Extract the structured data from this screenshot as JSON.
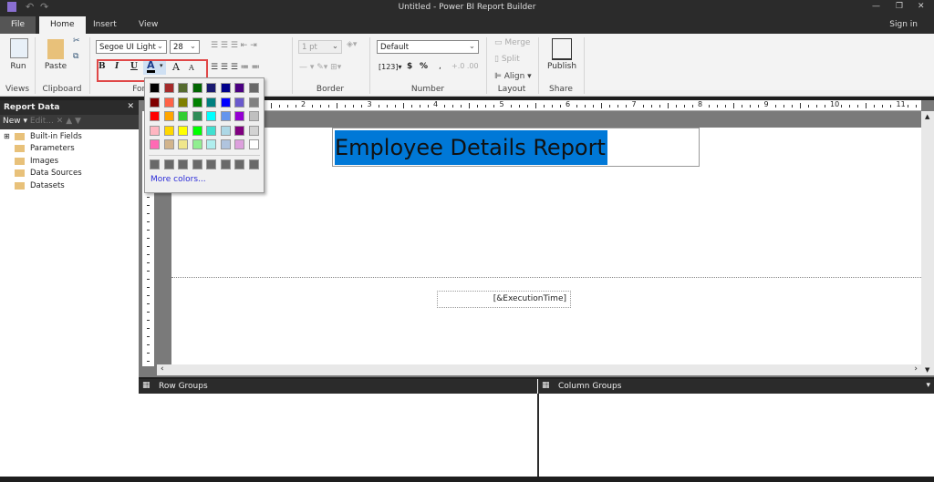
{
  "window": {
    "title": "Untitled - Power BI Report Builder",
    "sign_in": "Sign in"
  },
  "tabs": [
    "File",
    "Home",
    "Insert",
    "View"
  ],
  "ribbon": {
    "views": {
      "run": "Run",
      "group": "Views"
    },
    "clipboard": {
      "paste": "Paste",
      "group": "Clipboard"
    },
    "font": {
      "family": "Segoe UI Light",
      "size": "28",
      "bold": "B",
      "italic": "I",
      "underline": "U",
      "font_color": "A",
      "grow": "A",
      "shrink": "A",
      "group": "Font"
    },
    "border": {
      "width": "1 pt",
      "group": "Border"
    },
    "number": {
      "format": "Default",
      "dollar": "$",
      "percent": "%",
      "comma": ",",
      "group": "Number"
    },
    "layout": {
      "merge": "Merge",
      "split": "Split",
      "align": "Align",
      "group": "Layout"
    },
    "share": {
      "publish": "Publish",
      "group": "Share"
    }
  },
  "color_palette": {
    "rows": [
      [
        "#000000",
        "#a52a2a",
        "#556b2f",
        "#006400",
        "#191970",
        "#00008b",
        "#4b0082",
        "#696969"
      ],
      [
        "#800000",
        "#ff6347",
        "#808000",
        "#008000",
        "#008080",
        "#0000ff",
        "#6a5acd",
        "#808080"
      ],
      [
        "#ff0000",
        "#ffa500",
        "#32cd32",
        "#2e8b57",
        "#00ffff",
        "#6495ed",
        "#9400d3",
        "#c0c0c0"
      ],
      [
        "#ffb6c1",
        "#ffd700",
        "#ffff00",
        "#00ff00",
        "#40e0d0",
        "#add8e6",
        "#800080",
        "#d3d3d3"
      ],
      [
        "#ff69b4",
        "#d2b48c",
        "#f0e68c",
        "#90ee90",
        "#afeeee",
        "#b0c4de",
        "#dda0dd",
        "#ffffff"
      ]
    ],
    "recent": [
      "#696969",
      "#696969",
      "#696969",
      "#696969",
      "#696969",
      "#696969",
      "#696969",
      "#696969"
    ],
    "more": "More colors..."
  },
  "report_data": {
    "title": "Report Data",
    "new": "New",
    "edit": "Edit...",
    "items": [
      "Built-in Fields",
      "Parameters",
      "Images",
      "Data Sources",
      "Datasets"
    ]
  },
  "ruler": [
    "2",
    "3",
    "4",
    "5",
    "6",
    "7",
    "8",
    "9",
    "10",
    "11"
  ],
  "report": {
    "title": "Employee Details Report",
    "execution_time": "[&ExecutionTime]",
    "selection_color": "#0078d7"
  },
  "groups": {
    "row": "Row Groups",
    "column": "Column Groups"
  }
}
